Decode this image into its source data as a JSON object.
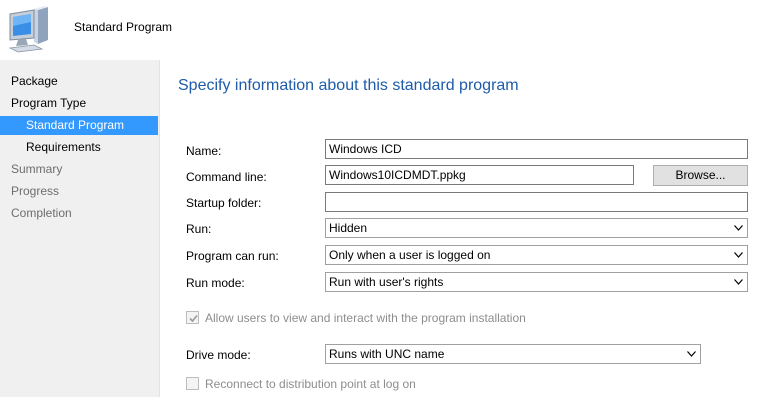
{
  "header": {
    "title": "Standard Program",
    "icon": "computer-icon"
  },
  "sidebar": {
    "items": [
      {
        "label": "Package",
        "state": "done"
      },
      {
        "label": "Program Type",
        "state": "done"
      },
      {
        "label": "Standard Program",
        "state": "selected"
      },
      {
        "label": "Requirements",
        "state": "done"
      },
      {
        "label": "Summary",
        "state": "pending"
      },
      {
        "label": "Progress",
        "state": "pending"
      },
      {
        "label": "Completion",
        "state": "pending"
      }
    ]
  },
  "main": {
    "title": "Specify information about this standard program",
    "fields": {
      "name": {
        "label": "Name:",
        "value": "Windows ICD"
      },
      "command_line": {
        "label": "Command line:",
        "value": "Windows10ICDMDT.ppkg",
        "browse_label": "Browse..."
      },
      "startup_folder": {
        "label": "Startup folder:",
        "value": ""
      },
      "run": {
        "label": "Run:",
        "value": "Hidden"
      },
      "program_can_run": {
        "label": "Program can run:",
        "value": "Only when a user is logged on"
      },
      "run_mode": {
        "label": "Run mode:",
        "value": "Run with user's rights"
      },
      "allow_interact": {
        "label": "Allow users to view and interact with the program installation",
        "checked": true,
        "enabled": false
      },
      "drive_mode": {
        "label": "Drive mode:",
        "value": "Runs with UNC name"
      },
      "reconnect": {
        "label": "Reconnect to distribution point at log on",
        "checked": false,
        "enabled": false
      }
    }
  },
  "colors": {
    "accent": "#3399ff",
    "title": "#1e5ba8",
    "sidebar_bg": "#f0f0f0",
    "disabled_text": "#8d8d8d"
  }
}
